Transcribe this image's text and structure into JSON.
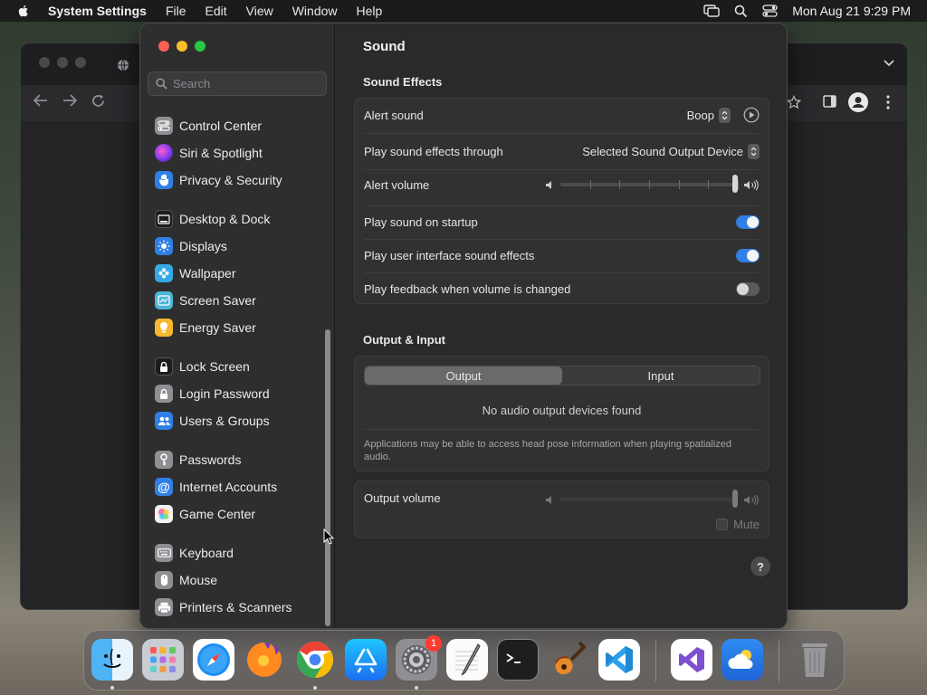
{
  "menubar": {
    "app_name": "System Settings",
    "items": [
      "File",
      "Edit",
      "View",
      "Window",
      "Help"
    ],
    "clock": "Mon Aug 21  9:29 PM"
  },
  "sidebar": {
    "search_placeholder": "Search",
    "items": [
      {
        "label": "Control Center",
        "icon": "control-center-icon",
        "color": "#8e8e93"
      },
      {
        "label": "Siri & Spotlight",
        "icon": "siri-icon",
        "color": "#c04bd6"
      },
      {
        "label": "Privacy & Security",
        "icon": "hand-icon",
        "color": "#2f7fe4"
      },
      {
        "label": "Desktop & Dock",
        "icon": "dock-icon",
        "color": "#1c1c1e"
      },
      {
        "label": "Displays",
        "icon": "sun-icon",
        "color": "#2f7fe4"
      },
      {
        "label": "Wallpaper",
        "icon": "flower-icon",
        "color": "#36a8e6"
      },
      {
        "label": "Screen Saver",
        "icon": "screen-saver-icon",
        "color": "#4bb6d8"
      },
      {
        "label": "Energy Saver",
        "icon": "lightbulb-icon",
        "color": "#f5b82e"
      },
      {
        "label": "Lock Screen",
        "icon": "lock-icon",
        "color": "#1c1c1e"
      },
      {
        "label": "Login Password",
        "icon": "lock-icon",
        "color": "#8e8e93"
      },
      {
        "label": "Users & Groups",
        "icon": "users-icon",
        "color": "#2f7fe4"
      },
      {
        "label": "Passwords",
        "icon": "key-icon",
        "color": "#8e8e93"
      },
      {
        "label": "Internet Accounts",
        "icon": "at-icon",
        "color": "#2f7fe4"
      },
      {
        "label": "Game Center",
        "icon": "game-center-icon",
        "color": "#f2f2f2"
      },
      {
        "label": "Keyboard",
        "icon": "keyboard-icon",
        "color": "#8e8e93"
      },
      {
        "label": "Mouse",
        "icon": "mouse-icon",
        "color": "#8e8e93"
      },
      {
        "label": "Printers & Scanners",
        "icon": "printer-icon",
        "color": "#8e8e93"
      }
    ]
  },
  "pane": {
    "title": "Sound",
    "sound_effects": {
      "heading": "Sound Effects",
      "alert_sound_label": "Alert sound",
      "alert_sound_value": "Boop",
      "play_through_label": "Play sound effects through",
      "play_through_value": "Selected Sound Output Device",
      "alert_volume_label": "Alert volume",
      "alert_volume_level": 1.0,
      "startup_label": "Play sound on startup",
      "startup_on": true,
      "ui_effects_label": "Play user interface sound effects",
      "ui_effects_on": true,
      "feedback_label": "Play feedback when volume is changed",
      "feedback_on": false
    },
    "output_input": {
      "heading": "Output & Input",
      "tabs": [
        "Output",
        "Input"
      ],
      "active_tab": "Output",
      "empty_message": "No audio output devices found",
      "note": "Applications may be able to access head pose information when playing spatialized audio.",
      "output_volume_label": "Output volume",
      "output_volume_level": 1.0,
      "mute_label": "Mute"
    },
    "help_label": "?"
  },
  "dock": {
    "apps": [
      "Finder",
      "Launchpad",
      "Safari",
      "Firefox",
      "Chrome",
      "App Store",
      "System Settings",
      "TextEdit",
      "Terminal",
      "GarageBand",
      "Visual Studio Code",
      "Visual Studio",
      "Weather",
      "Trash"
    ],
    "settings_badge": "1"
  },
  "colors": {
    "accent": "#2f7fe4",
    "window_bg": "#2a2a2a",
    "sidebar_bg": "#2e2e2f"
  }
}
